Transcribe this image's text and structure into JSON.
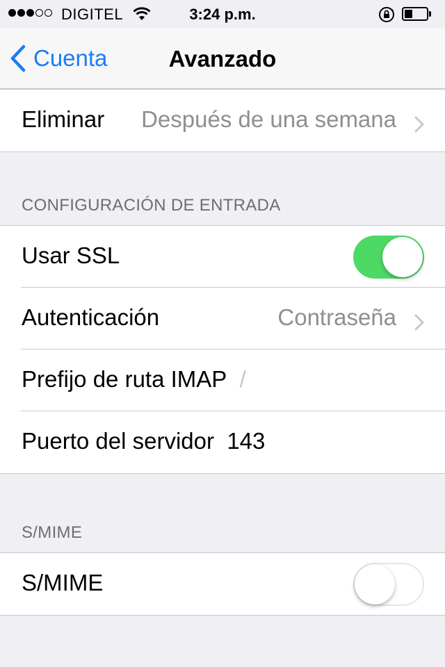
{
  "status_bar": {
    "carrier": "DIGITEL",
    "time": "3:24 p.m.",
    "signal_bars_filled": 3,
    "signal_bars_total": 5,
    "battery_level": 0.3
  },
  "nav": {
    "back_label": "Cuenta",
    "title": "Avanzado"
  },
  "rows": {
    "eliminar": {
      "label": "Eliminar",
      "value": "Después de una semana"
    }
  },
  "incoming": {
    "header": "CONFIGURACIÓN DE ENTRADA",
    "use_ssl": {
      "label": "Usar SSL",
      "enabled": true
    },
    "auth": {
      "label": "Autenticación",
      "value": "Contraseña"
    },
    "imap_prefix": {
      "label": "Prefijo de ruta IMAP",
      "value": "/"
    },
    "server_port": {
      "label": "Puerto del servidor",
      "value": "143"
    }
  },
  "smime": {
    "header": "S/MIME",
    "toggle": {
      "label": "S/MIME",
      "enabled": false
    }
  },
  "colors": {
    "accent": "#1a7cf5",
    "toggle_on": "#4cd964",
    "background": "#efeff4",
    "secondary_text": "#8e8e93"
  }
}
